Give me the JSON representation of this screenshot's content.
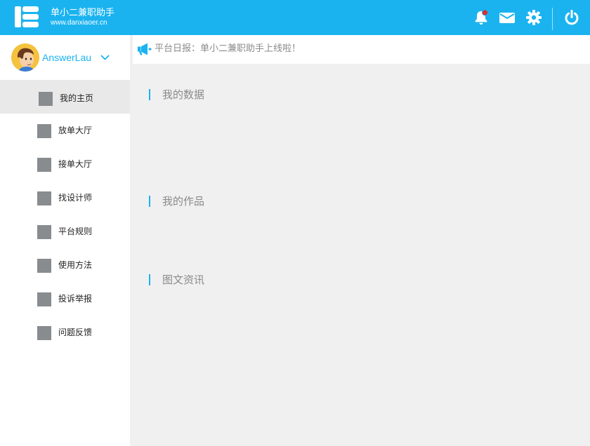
{
  "header": {
    "brand_name": "单小二兼职助手",
    "brand_url": "www.danxiaoer.cn",
    "icons": [
      "bell-icon",
      "mail-icon",
      "gear-icon",
      "power-icon"
    ],
    "accent_color": "#1ab3f0",
    "badge_color": "#e8262b"
  },
  "user": {
    "name": "AnswerLau"
  },
  "sidebar": {
    "items": [
      {
        "label": "我的主页",
        "active": true
      },
      {
        "label": "放单大厅"
      },
      {
        "label": "接单大厅"
      },
      {
        "label": "找设计师"
      },
      {
        "label": "平台规则"
      },
      {
        "label": "使用方法"
      },
      {
        "label": "投诉举报"
      },
      {
        "label": "问题反馈"
      }
    ]
  },
  "notice": {
    "text": "平台日报：单小二兼职助手上线啦！"
  },
  "sections": [
    {
      "title": "我的数据"
    },
    {
      "title": "我的作品"
    },
    {
      "title": "图文资讯"
    }
  ]
}
